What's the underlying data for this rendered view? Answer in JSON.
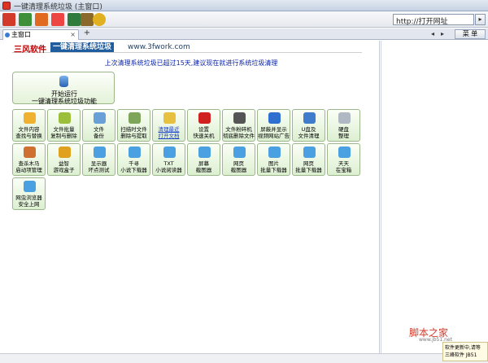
{
  "window": {
    "title": "一键清理系统垃圾 (主窗口)"
  },
  "toolbar": {
    "url_value": "http://打开网址",
    "go_label": "▸",
    "buttons": [
      {
        "name": "home",
        "color": "#d23a2a"
      },
      {
        "name": "refresh",
        "color": "#3d8f3a"
      },
      {
        "name": "house",
        "color": "#e06b20"
      },
      {
        "name": "cart",
        "color": "#e44"
      },
      {
        "name": "save",
        "color": "#2f7b3d"
      },
      {
        "name": "tools",
        "color": "#8a6a2a"
      },
      {
        "name": "chat",
        "color": "#e0b020"
      }
    ]
  },
  "tabs": {
    "active": "主窗口",
    "close": "×",
    "add": "+",
    "menu": "菜 单",
    "prev": "◂",
    "next": "▸"
  },
  "banner": {
    "brand1": "三风软件",
    "brand2": "一键清理系统垃圾",
    "url": "www.3fwork.com"
  },
  "notice": "上次清理系统垃圾已超过15天,建议现在就进行系统垃圾清理",
  "main_button": {
    "line1": "开始运行",
    "line2": "一键清理系统垃圾功能"
  },
  "tiles": [
    {
      "l1": "文件内容",
      "l2": "查找与替换",
      "icon": "#f0b030",
      "link": false
    },
    {
      "l1": "文件批量",
      "l2": "复制与删除",
      "icon": "#9bbf3a",
      "link": false
    },
    {
      "l1": "文件",
      "l2": "备份",
      "icon": "#6aa0d8",
      "link": false
    },
    {
      "l1": "扫描时文件",
      "l2": "删除与提取",
      "icon": "#7ea65a",
      "link": false
    },
    {
      "l1": "清理最近",
      "l2": "打开文档",
      "icon": "#e8c040",
      "link": true
    },
    {
      "l1": "设置",
      "l2": "快速关机",
      "icon": "#d02020",
      "link": false
    },
    {
      "l1": "文件粉碎机",
      "l2": "彻底删除文件",
      "icon": "#555555",
      "link": false
    },
    {
      "l1": "屏蔽并显示",
      "l2": "视频网站广告",
      "icon": "#2f6fd0",
      "link": false
    },
    {
      "l1": "U盘及",
      "l2": "文件清理",
      "icon": "#3f7ccc",
      "link": false
    },
    {
      "l1": "硬盘",
      "l2": "整理",
      "icon": "#b0b8c4",
      "link": false
    },
    {
      "l1": "查杀木马",
      "l2": "启动项管理",
      "icon": "#d07030",
      "link": false
    },
    {
      "l1": "益智",
      "l2": "游戏盒子",
      "icon": "#e0a020",
      "link": false
    },
    {
      "l1": "显示器",
      "l2": "坏点测试",
      "icon": "#4aa0e0",
      "link": false
    },
    {
      "l1": "千寻",
      "l2": "小说下载器",
      "icon": "#4aa0e0",
      "link": false
    },
    {
      "l1": "TXT",
      "l2": "小说阅读器",
      "icon": "#4aa0e0",
      "link": false
    },
    {
      "l1": "屏幕",
      "l2": "截图器",
      "icon": "#4aa0e0",
      "link": false
    },
    {
      "l1": "网页",
      "l2": "截图器",
      "icon": "#4aa0e0",
      "link": false
    },
    {
      "l1": "图片",
      "l2": "批量下载器",
      "icon": "#4aa0e0",
      "link": false
    },
    {
      "l1": "网页",
      "l2": "批量下载器",
      "icon": "#4aa0e0",
      "link": false
    },
    {
      "l1": "天天",
      "l2": "在宝箱",
      "icon": "#4aa0e0",
      "link": false
    },
    {
      "l1": "网虫浏览器",
      "l2": "安全上网",
      "icon": "#4aa0e0",
      "link": false
    }
  ],
  "watermark": {
    "text": "脚本之家",
    "url": "www.jb51.net"
  },
  "toast": {
    "line1": "软件更新中,请等",
    "line2": "三峰软件 JB51"
  }
}
